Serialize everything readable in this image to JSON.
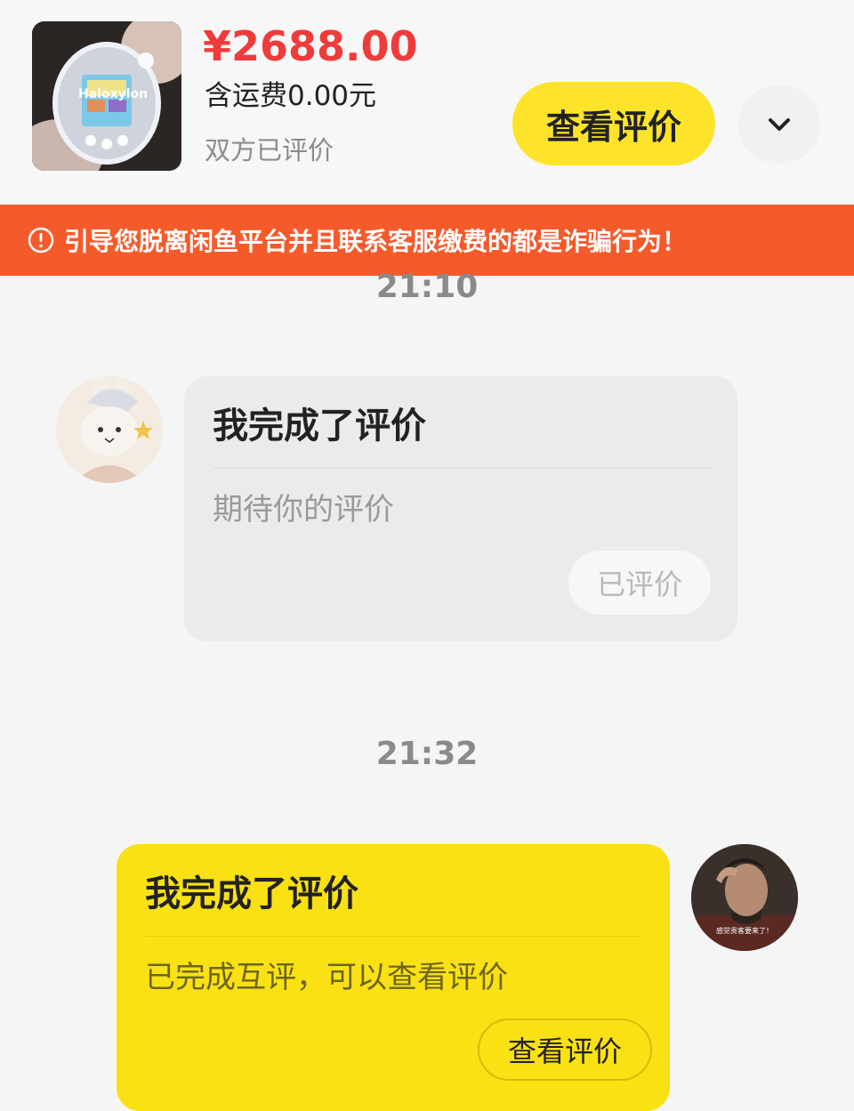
{
  "product": {
    "price": "¥2688.00",
    "shipping": "含运费0.00元",
    "status": "双方已评价",
    "thumbnail_text": "Haloxylon",
    "view_review_label": "查看评价"
  },
  "warning": {
    "text": "引导您脱离闲鱼平台并且联系客服缴费的都是诈骗行为！",
    "background": "#f55a2b"
  },
  "messages": [
    {
      "time": "21:10",
      "side": "left",
      "title": "我完成了评价",
      "subtitle": "期待你的评价",
      "button": "已评价"
    },
    {
      "time": "21:32",
      "side": "right",
      "title": "我完成了评价",
      "subtitle": "已完成互评，可以查看评价",
      "button": "查看评价",
      "avatar_caption": "感觉贵客要来了！"
    }
  ],
  "colors": {
    "accent_yellow": "#fde42a",
    "price_red": "#ef3b3b",
    "warning_orange": "#f55a2b"
  },
  "icons": {
    "warning": "exclamation-circle-icon",
    "expand": "chevron-down-icon"
  }
}
